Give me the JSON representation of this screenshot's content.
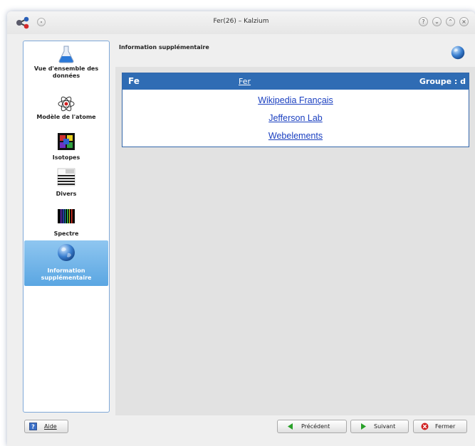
{
  "window": {
    "title": "Fer(26) – Kalzium"
  },
  "sidebar": {
    "items": [
      {
        "label": "Vue d'ensemble des données",
        "icon": "flask-icon"
      },
      {
        "label": "Modèle de l'atome",
        "icon": "atom-icon"
      },
      {
        "label": "Isotopes",
        "icon": "isotopes-icon"
      },
      {
        "label": "Divers",
        "icon": "misc-stripes-icon"
      },
      {
        "label": "Spectre",
        "icon": "spectrum-icon"
      },
      {
        "label": "Information supplémentaire",
        "icon": "globe-icon",
        "selected": true
      }
    ]
  },
  "content": {
    "title": "Information supplémentaire",
    "table": {
      "symbol": "Fe",
      "name": "Fer",
      "group": "Groupe : d",
      "links": [
        "Wikipedia Français",
        "Jefferson Lab",
        "Webelements"
      ]
    }
  },
  "buttons": {
    "help": {
      "label": "Aide",
      "mnemonic": "A"
    },
    "previous": {
      "label": "Précédent",
      "mnemonic": "P"
    },
    "next": {
      "label": "Suivant",
      "mnemonic": "S"
    },
    "close": {
      "label": "Fermer",
      "mnemonic": "F"
    }
  },
  "colors": {
    "header_blue": "#2f6cb4",
    "link_blue": "#1a3fc0",
    "selection_blue": "#5aa6e2"
  }
}
